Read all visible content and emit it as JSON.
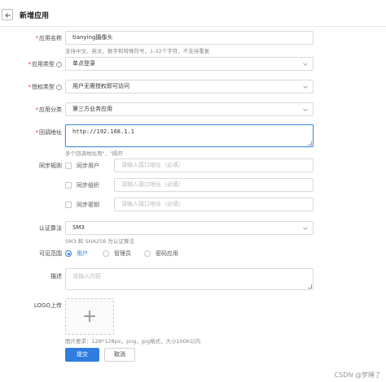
{
  "header": {
    "title": "新增应用"
  },
  "form": {
    "app_name": {
      "label": "应用名称",
      "value": "tianying摄像头",
      "help": "支持中文、英文、数字和特殊符号，1-32个字符，不支持重复"
    },
    "app_type": {
      "label": "应用类型",
      "value": "单点登录"
    },
    "auth_type": {
      "label": "授权类型",
      "value": "用户无需授权即可访问"
    },
    "app_category": {
      "label": "应用分类",
      "value": "第三方业务应用"
    },
    "callback_url": {
      "label": "回调地址",
      "value": "http://192.168.1.1",
      "help": "多个回调地址用\"，\"隔开"
    },
    "sync_rules": {
      "label": "同步规则",
      "items": [
        {
          "label": "同步用户",
          "placeholder": "请输入接口地址（必填）"
        },
        {
          "label": "同步组织",
          "placeholder": "请输入接口地址（必填）"
        },
        {
          "label": "同步密钥",
          "placeholder": "请输入接口地址（必填）"
        }
      ]
    },
    "auth_algorithm": {
      "label": "认证算法",
      "value": "SM3",
      "help": "SM3 和 SHA256 为认证算法"
    },
    "visibility": {
      "label": "可见范围",
      "options": [
        "用户",
        "管理员",
        "密码应用"
      ],
      "selected": "用户"
    },
    "description": {
      "label": "描述",
      "placeholder": "请输入内容"
    },
    "logo": {
      "label": "LOGO上传",
      "plus": "+",
      "help": "图片要求：128*128px，png，jpg格式，大小100K以内"
    },
    "submit_label": "提交",
    "cancel_label": "取消"
  },
  "watermark": "CSDN @梦睡了",
  "colors": {
    "primary": "#2f7de1",
    "required": "#f5222d",
    "focus_border": "#4a90e2"
  }
}
